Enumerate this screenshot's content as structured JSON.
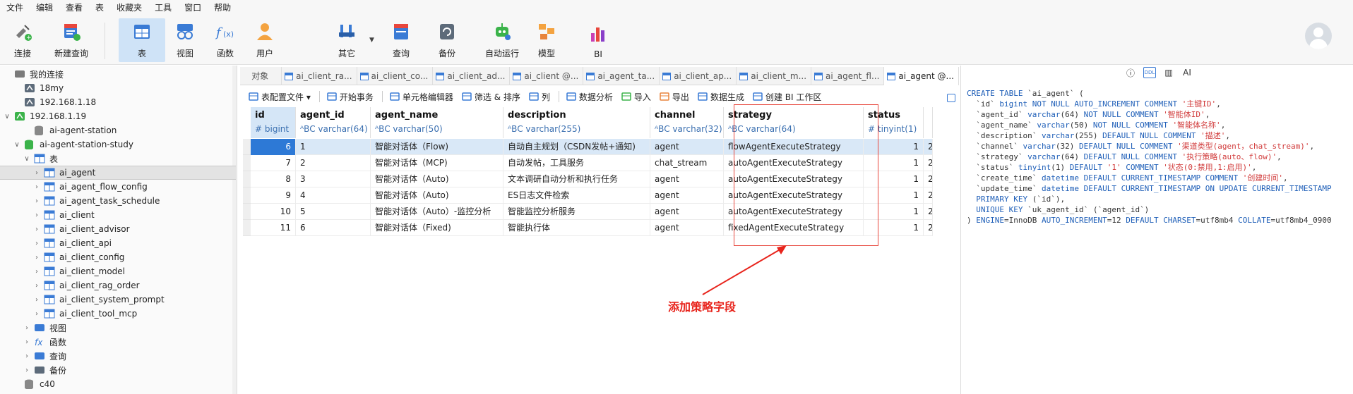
{
  "menu": [
    "文件",
    "编辑",
    "查看",
    "表",
    "收藏夹",
    "工具",
    "窗口",
    "帮助"
  ],
  "toolbar": {
    "buttons": [
      {
        "label": "连接",
        "icon": "connection-plug-icon"
      },
      {
        "label": "新建查询",
        "icon": "new-query-icon"
      },
      {
        "label": "表",
        "icon": "table-icon"
      },
      {
        "label": "视图",
        "icon": "view-glasses-icon"
      },
      {
        "label": "函数",
        "icon": "function-icon"
      },
      {
        "label": "用户",
        "icon": "user-icon"
      },
      {
        "label": "其它",
        "icon": "tools-icon"
      },
      {
        "label": "查询",
        "icon": "query-icon"
      },
      {
        "label": "备份",
        "icon": "backup-icon"
      },
      {
        "label": "自动运行",
        "icon": "robot-icon"
      },
      {
        "label": "模型",
        "icon": "model-icon"
      },
      {
        "label": "BI",
        "icon": "bi-icon"
      }
    ],
    "function_glyph": "f(x)"
  },
  "sidebar": {
    "items": [
      {
        "label": "我的连接",
        "arrow": "",
        "indent": 0,
        "icon": "connections-icon"
      },
      {
        "label": "18my",
        "arrow": "",
        "indent": 1,
        "icon": "db-server-icon"
      },
      {
        "label": "192.168.1.18",
        "arrow": "",
        "indent": 1,
        "icon": "db-server-icon"
      },
      {
        "label": "192.168.1.19",
        "arrow": "∨",
        "indent": 0,
        "icon": "db-server-active-icon"
      },
      {
        "label": "ai-agent-station",
        "arrow": "",
        "indent": 2,
        "icon": "database-icon"
      },
      {
        "label": "ai-agent-station-study",
        "arrow": "∨",
        "indent": 1,
        "icon": "database-open-icon"
      },
      {
        "label": "表",
        "arrow": "∨",
        "indent": 2,
        "icon": "tables-folder-icon"
      },
      {
        "label": "ai_agent",
        "arrow": "›",
        "indent": 3,
        "icon": "table-icon"
      },
      {
        "label": "ai_agent_flow_config",
        "arrow": "›",
        "indent": 3,
        "icon": "table-icon"
      },
      {
        "label": "ai_agent_task_schedule",
        "arrow": "›",
        "indent": 3,
        "icon": "table-icon"
      },
      {
        "label": "ai_client",
        "arrow": "›",
        "indent": 3,
        "icon": "table-icon"
      },
      {
        "label": "ai_client_advisor",
        "arrow": "›",
        "indent": 3,
        "icon": "table-icon"
      },
      {
        "label": "ai_client_api",
        "arrow": "›",
        "indent": 3,
        "icon": "table-icon"
      },
      {
        "label": "ai_client_config",
        "arrow": "›",
        "indent": 3,
        "icon": "table-icon"
      },
      {
        "label": "ai_client_model",
        "arrow": "›",
        "indent": 3,
        "icon": "table-icon"
      },
      {
        "label": "ai_client_rag_order",
        "arrow": "›",
        "indent": 3,
        "icon": "table-icon"
      },
      {
        "label": "ai_client_system_prompt",
        "arrow": "›",
        "indent": 3,
        "icon": "table-icon"
      },
      {
        "label": "ai_client_tool_mcp",
        "arrow": "›",
        "indent": 3,
        "icon": "table-icon"
      },
      {
        "label": "视图",
        "arrow": "›",
        "indent": 2,
        "icon": "views-folder-icon"
      },
      {
        "label": "函数",
        "arrow": "›",
        "indent": 2,
        "icon": "functions-folder-icon"
      },
      {
        "label": "查询",
        "arrow": "›",
        "indent": 2,
        "icon": "queries-folder-icon"
      },
      {
        "label": "备份",
        "arrow": "›",
        "indent": 2,
        "icon": "backups-folder-icon"
      },
      {
        "label": "c40",
        "arrow": "",
        "indent": 1,
        "icon": "database-icon"
      }
    ],
    "selected_index": 7
  },
  "tabs": [
    {
      "label": "对象",
      "kind": "obj"
    },
    {
      "label": "ai_client_ra...",
      "kind": "table"
    },
    {
      "label": "ai_client_co...",
      "kind": "table"
    },
    {
      "label": "ai_client_ad...",
      "kind": "table"
    },
    {
      "label": "ai_client @...",
      "kind": "table"
    },
    {
      "label": "ai_agent_ta...",
      "kind": "table"
    },
    {
      "label": "ai_client_ap...",
      "kind": "table"
    },
    {
      "label": "ai_client_m...",
      "kind": "table"
    },
    {
      "label": "ai_agent_fl...",
      "kind": "table"
    },
    {
      "label": "ai_agent @...",
      "kind": "table",
      "active": true
    }
  ],
  "subtoolbar": [
    {
      "label": "表配置文件 ▾",
      "icon": "table-profile-icon"
    },
    {
      "label": "开始事务",
      "icon": "transaction-icon"
    },
    {
      "label": "单元格编辑器",
      "icon": "cell-editor-icon"
    },
    {
      "label": "筛选 & 排序",
      "icon": "filter-sort-icon"
    },
    {
      "label": "列",
      "icon": "columns-icon"
    },
    {
      "label": "数据分析",
      "icon": "data-analysis-icon"
    },
    {
      "label": "导入",
      "icon": "import-icon"
    },
    {
      "label": "导出",
      "icon": "export-icon"
    },
    {
      "label": "数据生成",
      "icon": "data-generate-icon"
    },
    {
      "label": "创建 BI 工作区",
      "icon": "bi-workspace-icon"
    }
  ],
  "grid": {
    "columns": [
      {
        "name": "id",
        "type": "# bigint"
      },
      {
        "name": "agent_id",
        "type": "ᴬBC varchar(64)"
      },
      {
        "name": "agent_name",
        "type": "ᴬBC varchar(50)"
      },
      {
        "name": "description",
        "type": "ᴬBC varchar(255)"
      },
      {
        "name": "channel",
        "type": "ᴬBC varchar(32)"
      },
      {
        "name": "strategy",
        "type": "ᴬBC varchar(64)"
      },
      {
        "name": "status",
        "type": "# tinyint(1)"
      },
      {
        "name": "",
        "type": ""
      }
    ],
    "rows": [
      [
        "6",
        "1",
        "智能对话体（Flow)",
        "自动自主规划（CSDN发帖+通知)",
        "agent",
        "flowAgentExecuteStrategy",
        "1",
        "2"
      ],
      [
        "7",
        "2",
        "智能对话体（MCP)",
        "自动发帖，工具服务",
        "chat_stream",
        "autoAgentExecuteStrategy",
        "1",
        "2"
      ],
      [
        "8",
        "3",
        "智能对话体（Auto)",
        "文本调研自动分析和执行任务",
        "agent",
        "autoAgentExecuteStrategy",
        "1",
        "2"
      ],
      [
        "9",
        "4",
        "智能对话体（Auto)",
        "ES日志文件检索",
        "agent",
        "autoAgentExecuteStrategy",
        "1",
        "2"
      ],
      [
        "10",
        "5",
        "智能对话体（Auto）-监控分析",
        "智能监控分析服务",
        "agent",
        "autoAgentExecuteStrategy",
        "1",
        "2"
      ],
      [
        "11",
        "6",
        "智能对话体（Fixed)",
        "智能执行体",
        "agent",
        "fixedAgentExecuteStrategy",
        "1",
        "2"
      ]
    ]
  },
  "annotation": {
    "text": "添加策略字段",
    "color": "#e8241c"
  },
  "ddl": {
    "tools": [
      "ⓘ",
      "DDL",
      "▥",
      "AI"
    ],
    "lines": [
      "CREATE TABLE `ai_agent` (",
      "  `id` bigint NOT NULL AUTO_INCREMENT COMMENT '主键ID',",
      "  `agent_id` varchar(64) NOT NULL COMMENT '智能体ID',",
      "  `agent_name` varchar(50) NOT NULL COMMENT '智能体名称',",
      "  `description` varchar(255) DEFAULT NULL COMMENT '描述',",
      "  `channel` varchar(32) DEFAULT NULL COMMENT '渠道类型(agent，chat_stream)',",
      "  `strategy` varchar(64) DEFAULT NULL COMMENT '执行策略(auto、flow)',",
      "  `status` tinyint(1) DEFAULT '1' COMMENT '状态(0:禁用,1:启用)',",
      "  `create_time` datetime DEFAULT CURRENT_TIMESTAMP COMMENT '创建时间',",
      "  `update_time` datetime DEFAULT CURRENT_TIMESTAMP ON UPDATE CURRENT_TIMESTAMP",
      "  PRIMARY KEY (`id`),",
      "  UNIQUE KEY `uk_agent_id` (`agent_id`)",
      ") ENGINE=InnoDB AUTO_INCREMENT=12 DEFAULT CHARSET=utf8mb4 COLLATE=utf8mb4_0900"
    ]
  },
  "colors": {
    "accent": "#2d79d6",
    "highlight": "#e8463c",
    "keyword": "#1f5fb8",
    "string": "#d13b3b"
  }
}
